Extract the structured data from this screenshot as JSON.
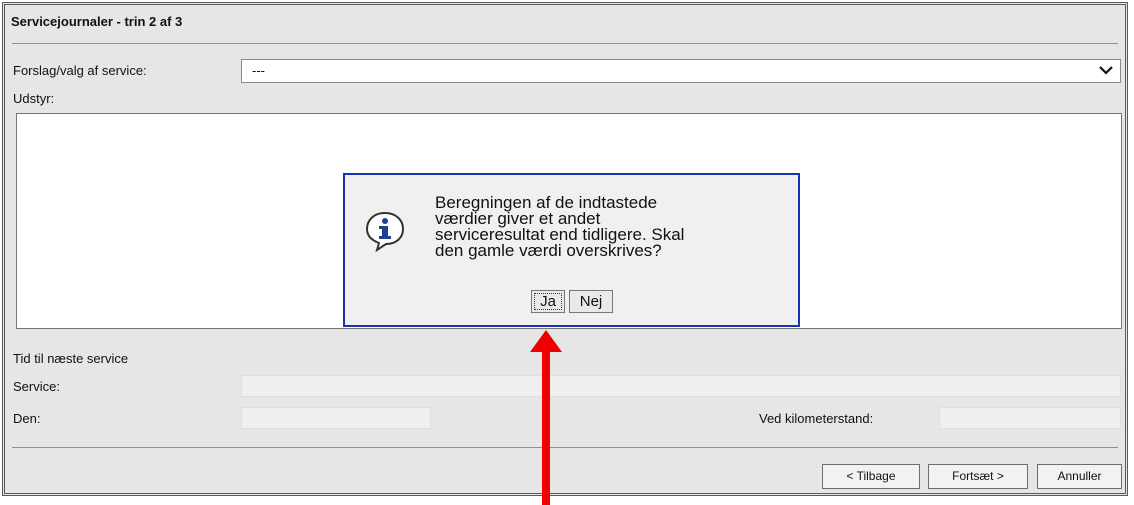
{
  "window": {
    "title": "Servicejournaler - trin 2 af 3"
  },
  "form": {
    "service_label": "Forslag/valg af service:",
    "service_value": "---",
    "equipment_label": "Udstyr:",
    "next_service_heading": "Tid til næste service",
    "service_field_label": "Service:",
    "date_label": "Den:",
    "km_label": "Ved kilometerstand:"
  },
  "buttons": {
    "back": "< Tilbage",
    "next": "Fortsæt >",
    "cancel": "Annuller"
  },
  "dialog": {
    "message_lines": [
      "Beregningen af de indtastede",
      "værdier giver et andet",
      "serviceresultat end tidligere. Skal",
      "den gamle værdi overskrives?"
    ],
    "yes": "Ja",
    "no": "Nej",
    "icon": "info-icon"
  },
  "annotation": {
    "arrow_color": "#ee0000"
  },
  "colors": {
    "dialog_border": "#1a33b5",
    "rule": "#6b9ac4",
    "panel_bg": "#e6e6e6"
  }
}
